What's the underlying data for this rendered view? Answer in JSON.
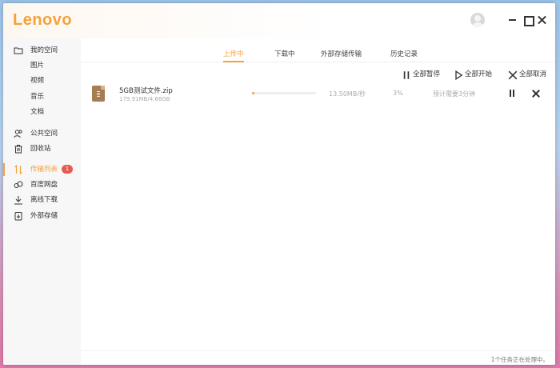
{
  "app": {
    "logo": "Lenovo",
    "accent": "#f3a23c",
    "badge_color": "#e85a50"
  },
  "window_controls": [
    "minimize-icon",
    "maximize-icon",
    "close-icon"
  ],
  "sidebar": {
    "items": [
      {
        "label": "我的空间",
        "icon": "folder-icon"
      },
      {
        "label": "图片"
      },
      {
        "label": "视频"
      },
      {
        "label": "音乐"
      },
      {
        "label": "文档"
      },
      {
        "label": "公共空间",
        "icon": "users-icon"
      },
      {
        "label": "回收站",
        "icon": "trash-icon"
      },
      {
        "label": "传输列表",
        "icon": "transfer-icon",
        "active": true,
        "badge": "1"
      },
      {
        "label": "百度网盘",
        "icon": "cloud-icon"
      },
      {
        "label": "离线下载",
        "icon": "download-icon"
      },
      {
        "label": "外部存储",
        "icon": "external-storage-icon"
      }
    ]
  },
  "tabs": [
    {
      "label": "上传中",
      "active": true
    },
    {
      "label": "下载中"
    },
    {
      "label": "外部存储传输"
    },
    {
      "label": "历史记录"
    }
  ],
  "actions": {
    "pause_all": "全部暂停",
    "start_all": "全部开始",
    "cancel_all": "全部取消"
  },
  "transfer": {
    "name": "5GB测试文件.zip",
    "size": "179.91MB/4.66GB",
    "speed": "13.50MB/秒",
    "percent": "3%",
    "progress": 0.03,
    "eta": "预计需要3分钟"
  },
  "status": "1个任务正在处理中。"
}
